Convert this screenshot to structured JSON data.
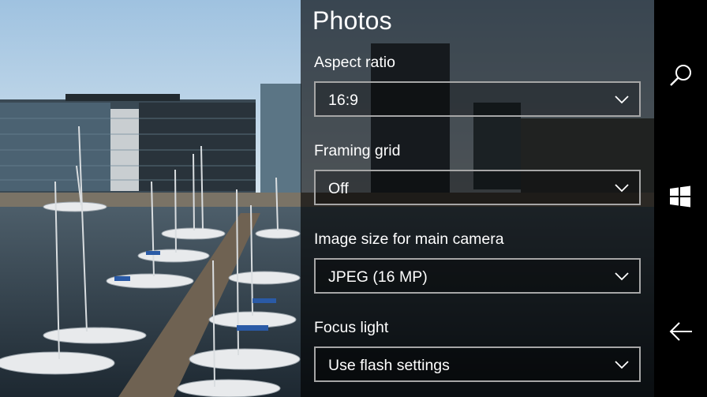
{
  "panel": {
    "title": "Photos",
    "settings": [
      {
        "label": "Aspect ratio",
        "value": "16:9"
      },
      {
        "label": "Framing grid",
        "value": "Off"
      },
      {
        "label": "Image size for main camera",
        "value": "JPEG (16 MP)"
      },
      {
        "label": "Focus light",
        "value": "Use flash settings"
      }
    ]
  },
  "rail": {
    "icons": [
      "search-icon",
      "windows-icon",
      "back-arrow-icon"
    ]
  },
  "colors": {
    "panel_overlay": "#000000",
    "combo_border": "#a6a6a6",
    "rail_background": "#000000"
  }
}
